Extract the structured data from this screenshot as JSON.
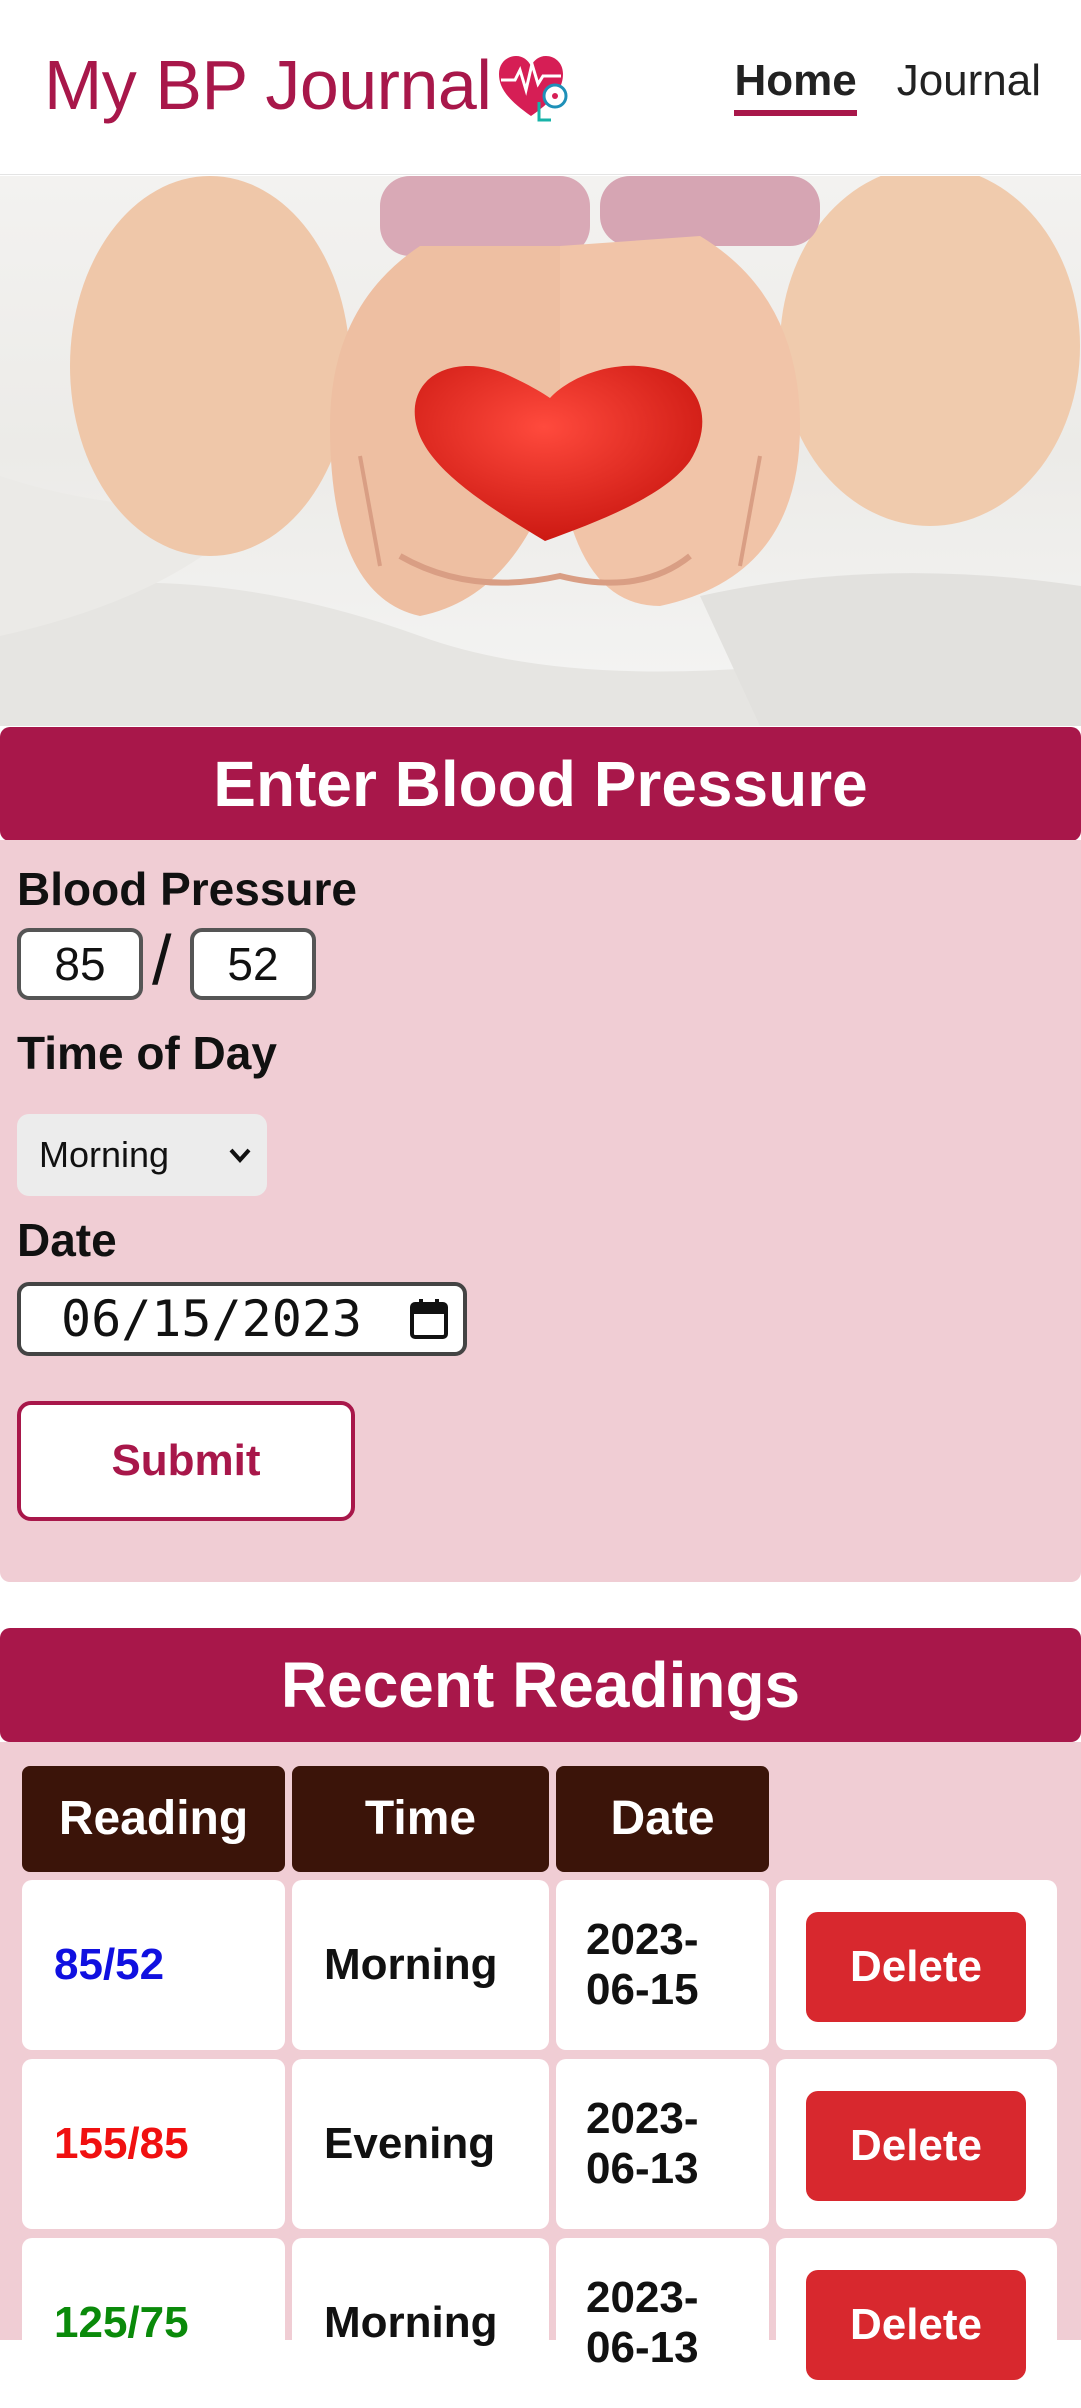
{
  "header": {
    "app_title": "My BP Journal",
    "nav": [
      {
        "label": "Home",
        "active": true
      },
      {
        "label": "Journal",
        "active": false
      }
    ]
  },
  "entry": {
    "section_title": "Enter Blood Pressure",
    "bp_label": "Blood Pressure",
    "systolic_value": "85",
    "separator": "/",
    "diastolic_value": "52",
    "time_label": "Time of Day",
    "time_selected": "Morning",
    "date_label": "Date",
    "date_value": "06/15/2023",
    "submit_label": "Submit"
  },
  "readings": {
    "section_title": "Recent Readings",
    "columns": [
      "Reading",
      "Time",
      "Date"
    ],
    "delete_label": "Delete",
    "rows": [
      {
        "reading": "85/52",
        "reading_color": "#1010e0",
        "time": "Morning",
        "date_line1": "2023-",
        "date_line2": "06-15"
      },
      {
        "reading": "155/85",
        "reading_color": "#f01010",
        "time": "Evening",
        "date_line1": "2023-",
        "date_line2": "06-13"
      },
      {
        "reading": "125/75",
        "reading_color": "#0a8a0a",
        "time": "Morning",
        "date_line1": "2023-",
        "date_line2": "06-13"
      }
    ]
  },
  "colors": {
    "brand": "#a8174a",
    "panel": "#f0cdd4",
    "table_header": "#3b1409",
    "delete": "#d8282e"
  },
  "icons": [
    "heart-pulse-logo-icon",
    "chevron-down-icon",
    "calendar-icon"
  ]
}
